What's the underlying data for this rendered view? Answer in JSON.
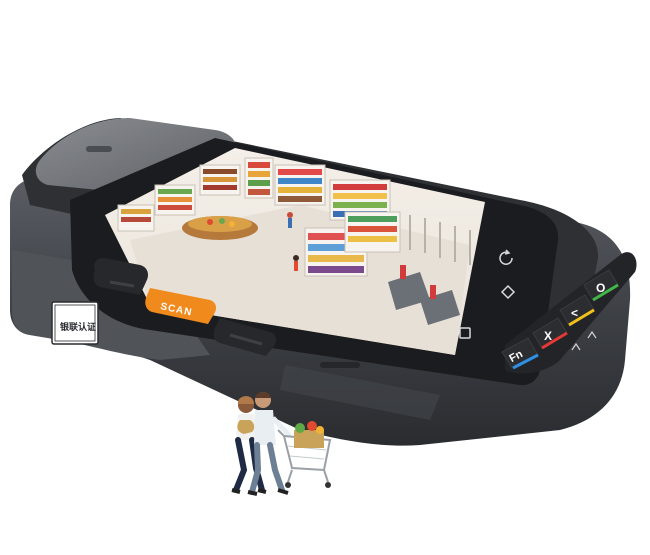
{
  "device": {
    "scan_button_label": "SCAN",
    "badge_text": "银联认证",
    "keys": {
      "fn": "Fn",
      "cancel": "X",
      "back": "<",
      "ok": "O"
    },
    "nav_icons": [
      "back-icon",
      "home-icon",
      "menu-icon"
    ],
    "colors": {
      "body": "#3a3d42",
      "body_light": "#5b5f66",
      "grip": "#6e7278",
      "scan_button": "#f08a1c",
      "key_fn": "#2f8fe0",
      "key_cancel": "#e53935",
      "key_back": "#f2c21b",
      "key_ok": "#43b649"
    }
  },
  "screen": {
    "scene": "supermarket-illustration"
  },
  "figures": {
    "scene": "couple-with-shopping-cart"
  }
}
